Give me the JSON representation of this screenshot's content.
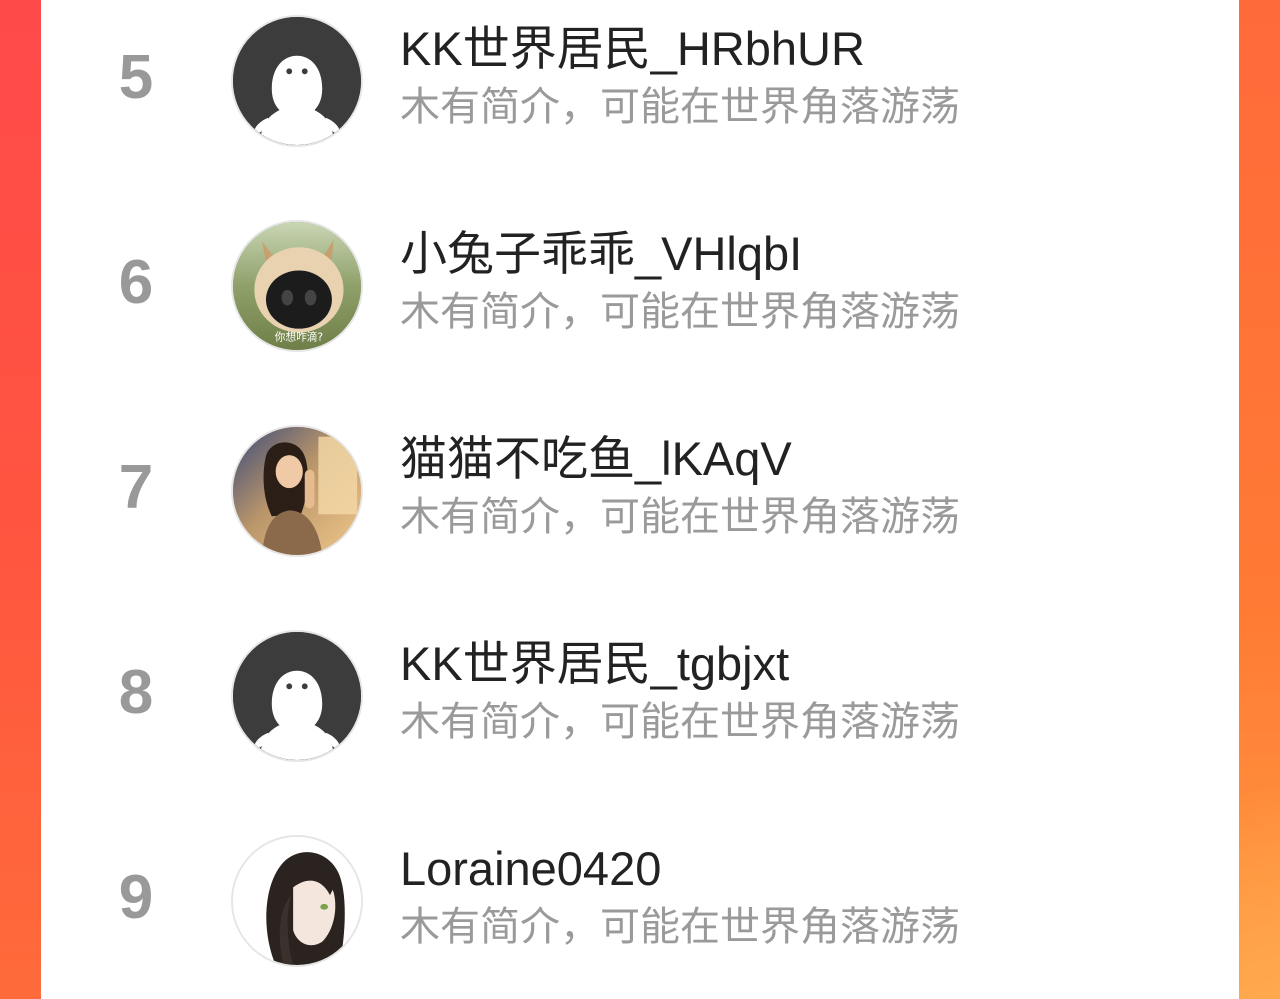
{
  "colors": {
    "accent_left": "#ff4a4a",
    "accent_right": "#ff7a34",
    "rank_text": "#999999",
    "name_text": "#222222",
    "bio_text": "#9a9a9a"
  },
  "users": [
    {
      "rank": "5",
      "name": "KK世界居民_HRbhUR",
      "bio": "木有简介，可能在世界角落游荡",
      "avatar": "default-avatar"
    },
    {
      "rank": "6",
      "name": "小兔子乖乖_VHlqbI",
      "bio": "木有简介，可能在世界角落游荡",
      "avatar": "dog-photo-avatar",
      "avatar_caption": "你想咋滴?"
    },
    {
      "rank": "7",
      "name": "猫猫不吃鱼_lKAqV",
      "bio": "木有简介，可能在世界角落游荡",
      "avatar": "girl-photo-avatar"
    },
    {
      "rank": "8",
      "name": "KK世界居民_tgbjxt",
      "bio": "木有简介，可能在世界角落游荡",
      "avatar": "default-avatar"
    },
    {
      "rank": "9",
      "name": "Loraine0420",
      "bio": "木有简介，可能在世界角落游荡",
      "avatar": "anime-girl-avatar"
    }
  ]
}
